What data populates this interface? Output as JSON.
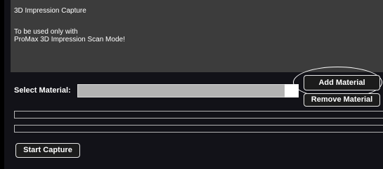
{
  "info": {
    "title": "3D Impression Capture",
    "line1": "To be used only with",
    "line2": "ProMax 3D Impression Scan Mode!"
  },
  "material": {
    "label": "Select Material:",
    "selected": ""
  },
  "buttons": {
    "add": "Add Material",
    "remove": "Remove Material",
    "start": "Start Capture"
  },
  "progress": {
    "bar1": 0,
    "bar2": 0
  },
  "colors": {
    "page_background": "#121218",
    "info_panel": "#3c3c3c",
    "select_field": "#b3b3b3",
    "button_border": "#e6e6e6",
    "highlight": "#ffffff"
  }
}
